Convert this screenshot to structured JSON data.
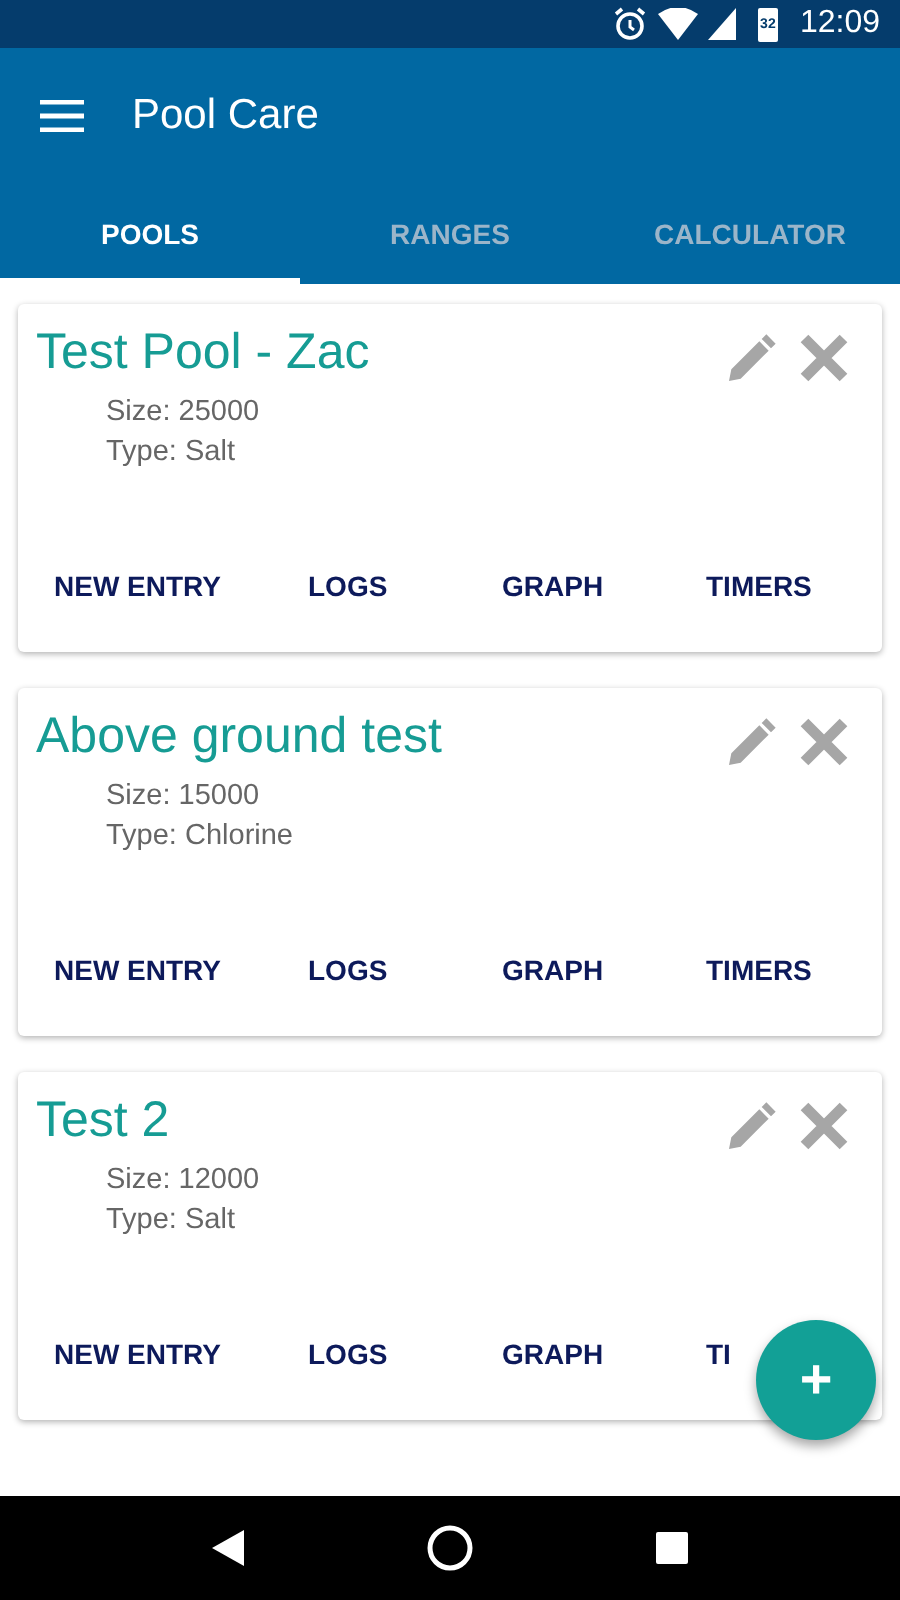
{
  "status_bar": {
    "battery": "32",
    "time": "12:09"
  },
  "app_bar": {
    "title": "Pool Care"
  },
  "tabs": [
    {
      "label": "POOLS",
      "selected": true
    },
    {
      "label": "RANGES",
      "selected": false
    },
    {
      "label": "CALCULATOR",
      "selected": false
    }
  ],
  "pools": [
    {
      "name": "Test Pool - Zac",
      "size": "Size: 25000",
      "type": "Type: Salt",
      "actions": [
        "NEW ENTRY",
        "LOGS",
        "GRAPH",
        "TIMERS"
      ]
    },
    {
      "name": "Above ground test",
      "size": "Size: 15000",
      "type": "Type: Chlorine",
      "actions": [
        "NEW ENTRY",
        "LOGS",
        "GRAPH",
        "TIMERS"
      ]
    },
    {
      "name": "Test 2",
      "size": "Size: 12000",
      "type": "Type: Salt",
      "actions": [
        "NEW ENTRY",
        "LOGS",
        "GRAPH",
        "TI"
      ]
    }
  ],
  "fab": {
    "label": "+"
  }
}
